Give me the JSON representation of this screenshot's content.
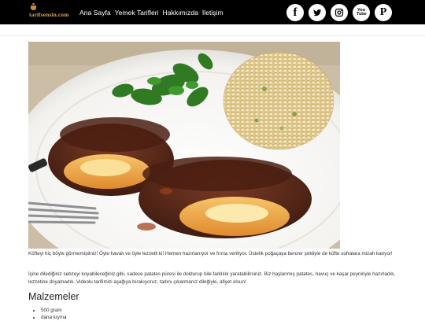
{
  "header": {
    "logo_text": "tarifsensin.com",
    "nav": [
      {
        "label": "Ana Sayfa"
      },
      {
        "label": "Yemek Tarifleri"
      },
      {
        "label": "Hakkımızda"
      },
      {
        "label": "İletişim"
      }
    ],
    "social": [
      {
        "name": "facebook",
        "glyph": "f"
      },
      {
        "name": "twitter",
        "glyph": ""
      },
      {
        "name": "instagram",
        "glyph": ""
      },
      {
        "name": "youtube",
        "glyph": "You Tube"
      },
      {
        "name": "pinterest",
        "glyph": "P"
      }
    ]
  },
  "article": {
    "paragraph_1": "Köfteyi hiç böyle görmemiştiniz! Öyle havalı ve öyle lezzetli ki! Hemen hazırlanıyor ve fırına veriliyor. Üstelik poğaçaya benzer şekliyle de köfte sofralara mizah katıyor!",
    "paragraph_2": "İçine dilediğiniz sebzeyi koyabileceğiniz gibi, sadece patates püresi ile doldurup bile farklılık yaratabilirsiniz. Biz haşlanmış patates, havuç ve kaşar peyniriyle hazırladık, lezzetine doyamadık. Videolu tarifimizi aşağıya bırakıyoruz, tadını çıkarmanız dileğiyle, afiyet olsun!",
    "ingredients_heading": "Malzemeler",
    "ingredients": [
      {
        "text": "500 gram"
      },
      {
        "text": "dana kıyma"
      }
    ]
  },
  "colors": {
    "topbar": "#000000",
    "logo": "#d4a45a"
  }
}
